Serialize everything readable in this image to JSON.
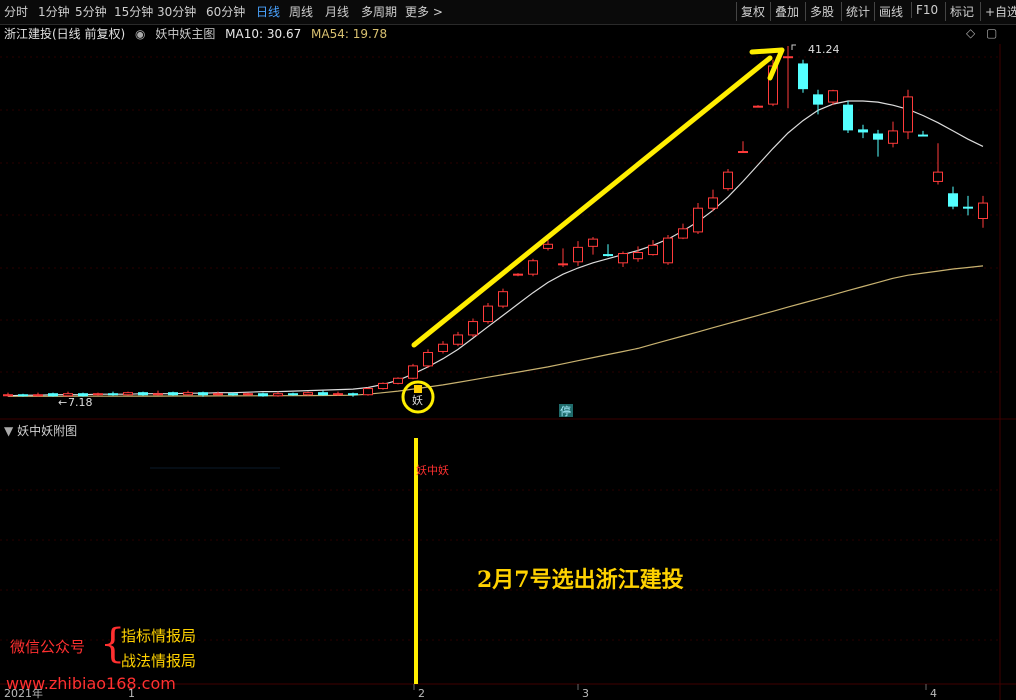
{
  "toolbar": {
    "periods": [
      "分时",
      "1分钟",
      "5分钟",
      "15分钟",
      "30分钟",
      "60分钟",
      "日线",
      "周线",
      "月线",
      "多周期",
      "更多 >"
    ],
    "active_period": "日线",
    "right_buttons": [
      "复权",
      "叠加",
      "多股",
      "统计",
      "画线",
      "F10",
      "标记",
      "+自选"
    ]
  },
  "main_panel": {
    "stock_title": "浙江建投(日线 前复权)",
    "indicator_name": "妖中妖主图",
    "ma10_label": "MA10: 30.67",
    "ma54_label": "MA54: 19.78",
    "high_label": "41.24",
    "low_label": "7.18",
    "signal_label": "妖",
    "limit_badge": "停"
  },
  "sub_panel": {
    "title": "妖中妖附图",
    "signal_label": "妖中妖"
  },
  "annotation": {
    "title": "2月7号选出浙江建投",
    "wechat_label": "微信公众号",
    "brace": "{",
    "indicator_report": "指标情报局",
    "tactics_report": "战法情报局",
    "website": "www.zhibiao168.com"
  },
  "time_axis": {
    "labels": [
      "2021年",
      "1",
      "2",
      "3",
      "4"
    ]
  },
  "colors": {
    "up": "#ff3b3b",
    "down": "#54ffff",
    "ma10": "#dcdcdc",
    "ma54": "#c8b270",
    "annotation": "#ffd200",
    "active_period": "#4aa3ff",
    "watermark": "#ff3030"
  },
  "chart_data": {
    "type": "candlestick",
    "price_high": 41.24,
    "price_low": 7.18,
    "candles": [
      {
        "o": 7.3,
        "c": 7.4,
        "h": 7.6,
        "l": 7.2,
        "dir": "up"
      },
      {
        "o": 7.4,
        "c": 7.3,
        "h": 7.5,
        "l": 7.2,
        "dir": "down"
      },
      {
        "o": 7.3,
        "c": 7.4,
        "h": 7.6,
        "l": 7.2,
        "dir": "up"
      },
      {
        "o": 7.5,
        "c": 7.3,
        "h": 7.6,
        "l": 7.2,
        "dir": "down"
      },
      {
        "o": 7.3,
        "c": 7.5,
        "h": 7.7,
        "l": 7.2,
        "dir": "up"
      },
      {
        "o": 7.5,
        "c": 7.3,
        "h": 7.6,
        "l": 7.2,
        "dir": "down"
      },
      {
        "o": 7.4,
        "c": 7.5,
        "h": 7.6,
        "l": 7.3,
        "dir": "up"
      },
      {
        "o": 7.5,
        "c": 7.4,
        "h": 7.7,
        "l": 7.3,
        "dir": "down"
      },
      {
        "o": 7.4,
        "c": 7.6,
        "h": 7.7,
        "l": 7.3,
        "dir": "up"
      },
      {
        "o": 7.6,
        "c": 7.4,
        "h": 7.7,
        "l": 7.3,
        "dir": "down"
      },
      {
        "o": 7.4,
        "c": 7.5,
        "h": 7.8,
        "l": 7.3,
        "dir": "up"
      },
      {
        "o": 7.6,
        "c": 7.4,
        "h": 7.7,
        "l": 7.3,
        "dir": "down"
      },
      {
        "o": 7.4,
        "c": 7.6,
        "h": 7.8,
        "l": 7.3,
        "dir": "up"
      },
      {
        "o": 7.6,
        "c": 7.4,
        "h": 7.7,
        "l": 7.2,
        "dir": "down"
      },
      {
        "o": 7.4,
        "c": 7.5,
        "h": 7.7,
        "l": 7.3,
        "dir": "up"
      },
      {
        "o": 7.5,
        "c": 7.4,
        "h": 7.6,
        "l": 7.3,
        "dir": "down"
      },
      {
        "o": 7.4,
        "c": 7.5,
        "h": 7.6,
        "l": 7.3,
        "dir": "up"
      },
      {
        "o": 7.5,
        "c": 7.3,
        "h": 7.6,
        "l": 7.2,
        "dir": "down"
      },
      {
        "o": 7.3,
        "c": 7.5,
        "h": 7.7,
        "l": 7.2,
        "dir": "up"
      },
      {
        "o": 7.5,
        "c": 7.4,
        "h": 7.6,
        "l": 7.3,
        "dir": "down"
      },
      {
        "o": 7.4,
        "c": 7.6,
        "h": 7.7,
        "l": 7.3,
        "dir": "up"
      },
      {
        "o": 7.6,
        "c": 7.4,
        "h": 7.8,
        "l": 7.3,
        "dir": "down"
      },
      {
        "o": 7.4,
        "c": 7.5,
        "h": 7.7,
        "l": 7.3,
        "dir": "up"
      },
      {
        "o": 7.5,
        "c": 7.4,
        "h": 7.6,
        "l": 7.2,
        "dir": "down"
      },
      {
        "o": 7.4,
        "c": 8.0,
        "h": 8.1,
        "l": 7.3,
        "dir": "up"
      },
      {
        "o": 8.0,
        "c": 8.5,
        "h": 8.6,
        "l": 7.9,
        "dir": "up"
      },
      {
        "o": 8.5,
        "c": 9.0,
        "h": 9.1,
        "l": 8.4,
        "dir": "up"
      },
      {
        "o": 9.0,
        "c": 10.2,
        "h": 10.4,
        "l": 8.9,
        "dir": "up"
      },
      {
        "o": 10.2,
        "c": 11.5,
        "h": 11.8,
        "l": 10.0,
        "dir": "up"
      },
      {
        "o": 11.6,
        "c": 12.3,
        "h": 12.6,
        "l": 11.4,
        "dir": "up"
      },
      {
        "o": 12.3,
        "c": 13.2,
        "h": 13.5,
        "l": 12.1,
        "dir": "up"
      },
      {
        "o": 13.2,
        "c": 14.5,
        "h": 14.8,
        "l": 13.0,
        "dir": "up"
      },
      {
        "o": 14.5,
        "c": 16.0,
        "h": 16.3,
        "l": 14.3,
        "dir": "up"
      },
      {
        "o": 16.0,
        "c": 17.4,
        "h": 17.7,
        "l": 15.8,
        "dir": "up"
      },
      {
        "o": 19.1,
        "c": 19.1,
        "h": 19.2,
        "l": 18.9,
        "dir": "up"
      },
      {
        "o": 19.1,
        "c": 20.4,
        "h": 20.6,
        "l": 18.9,
        "dir": "up"
      },
      {
        "o": 21.6,
        "c": 22.0,
        "h": 22.4,
        "l": 21.4,
        "dir": "up"
      },
      {
        "o": 20.1,
        "c": 20.1,
        "h": 21.6,
        "l": 19.8,
        "dir": "up"
      },
      {
        "o": 20.3,
        "c": 21.7,
        "h": 22.3,
        "l": 19.9,
        "dir": "up"
      },
      {
        "o": 21.8,
        "c": 22.5,
        "h": 22.7,
        "l": 21.0,
        "dir": "up"
      },
      {
        "o": 21.0,
        "c": 21.0,
        "h": 22.0,
        "l": 20.8,
        "dir": "down"
      },
      {
        "o": 20.2,
        "c": 21.1,
        "h": 21.3,
        "l": 19.8,
        "dir": "up"
      },
      {
        "o": 20.6,
        "c": 21.2,
        "h": 21.8,
        "l": 20.3,
        "dir": "up"
      },
      {
        "o": 21.0,
        "c": 21.9,
        "h": 22.4,
        "l": 20.9,
        "dir": "up"
      },
      {
        "o": 20.2,
        "c": 22.6,
        "h": 22.9,
        "l": 20.0,
        "dir": "up"
      },
      {
        "o": 22.6,
        "c": 23.5,
        "h": 24.0,
        "l": 22.5,
        "dir": "up"
      },
      {
        "o": 23.2,
        "c": 25.5,
        "h": 26.0,
        "l": 23.0,
        "dir": "up"
      },
      {
        "o": 25.5,
        "c": 26.5,
        "h": 27.3,
        "l": 25.2,
        "dir": "up"
      },
      {
        "o": 27.4,
        "c": 29.0,
        "h": 29.3,
        "l": 27.2,
        "dir": "up"
      },
      {
        "o": 31.0,
        "c": 31.0,
        "h": 32.0,
        "l": 31.0,
        "dir": "up"
      },
      {
        "o": 35.4,
        "c": 35.4,
        "h": 35.5,
        "l": 35.3,
        "dir": "up"
      },
      {
        "o": 35.6,
        "c": 39.3,
        "h": 39.9,
        "l": 35.4,
        "dir": "up"
      },
      {
        "o": 40.2,
        "c": 40.2,
        "h": 41.24,
        "l": 35.2,
        "dir": "up"
      },
      {
        "o": 39.5,
        "c": 37.1,
        "h": 39.9,
        "l": 36.7,
        "dir": "down"
      },
      {
        "o": 36.5,
        "c": 35.6,
        "h": 37.0,
        "l": 34.6,
        "dir": "down"
      },
      {
        "o": 35.8,
        "c": 36.9,
        "h": 37.0,
        "l": 35.5,
        "dir": "up"
      },
      {
        "o": 35.5,
        "c": 33.1,
        "h": 35.9,
        "l": 32.8,
        "dir": "down"
      },
      {
        "o": 33.1,
        "c": 32.9,
        "h": 33.6,
        "l": 32.3,
        "dir": "down"
      },
      {
        "o": 32.7,
        "c": 32.2,
        "h": 33.1,
        "l": 30.5,
        "dir": "down"
      },
      {
        "o": 31.8,
        "c": 33.0,
        "h": 33.9,
        "l": 31.4,
        "dir": "up"
      },
      {
        "o": 32.9,
        "c": 36.3,
        "h": 37.0,
        "l": 32.2,
        "dir": "up"
      },
      {
        "o": 32.6,
        "c": 32.6,
        "h": 33.0,
        "l": 32.5,
        "dir": "down"
      },
      {
        "o": 28.1,
        "c": 29.0,
        "h": 31.8,
        "l": 27.8,
        "dir": "up"
      },
      {
        "o": 26.9,
        "c": 25.7,
        "h": 27.6,
        "l": 25.4,
        "dir": "down"
      },
      {
        "o": 25.6,
        "c": 25.6,
        "h": 26.7,
        "l": 24.8,
        "dir": "down"
      },
      {
        "o": 24.5,
        "c": 26.0,
        "h": 26.7,
        "l": 23.6,
        "dir": "up"
      }
    ],
    "ma10": [
      7.3,
      7.35,
      7.35,
      7.4,
      7.4,
      7.4,
      7.45,
      7.45,
      7.45,
      7.5,
      7.5,
      7.5,
      7.55,
      7.55,
      7.6,
      7.6,
      7.65,
      7.7,
      7.7,
      7.75,
      7.8,
      7.85,
      7.9,
      7.95,
      8.1,
      8.4,
      8.8,
      9.4,
      10.1,
      10.9,
      11.8,
      12.9,
      14.0,
      15.1,
      16.2,
      17.3,
      18.3,
      19.1,
      19.7,
      20.2,
      20.6,
      21.0,
      21.4,
      21.9,
      22.5,
      23.3,
      24.2,
      25.3,
      26.6,
      28.1,
      29.7,
      31.3,
      32.8,
      34.0,
      35.0,
      35.6,
      35.9,
      35.9,
      35.8,
      35.5,
      35.1,
      34.5,
      33.8,
      33.0,
      32.2,
      31.5
    ],
    "ma54": [
      7.25,
      7.25,
      7.25,
      7.25,
      7.25,
      7.26,
      7.26,
      7.26,
      7.27,
      7.27,
      7.27,
      7.28,
      7.28,
      7.28,
      7.29,
      7.29,
      7.3,
      7.3,
      7.31,
      7.31,
      7.32,
      7.33,
      7.34,
      7.35,
      7.45,
      7.6,
      7.75,
      7.95,
      8.15,
      8.35,
      8.6,
      8.85,
      9.1,
      9.35,
      9.6,
      9.85,
      10.1,
      10.4,
      10.7,
      11.0,
      11.3,
      11.6,
      11.9,
      12.3,
      12.7,
      13.1,
      13.5,
      13.9,
      14.3,
      14.7,
      15.1,
      15.5,
      15.9,
      16.3,
      16.7,
      17.1,
      17.5,
      17.9,
      18.3,
      18.7,
      19.0,
      19.2,
      19.4,
      19.6,
      19.75,
      19.9
    ]
  }
}
